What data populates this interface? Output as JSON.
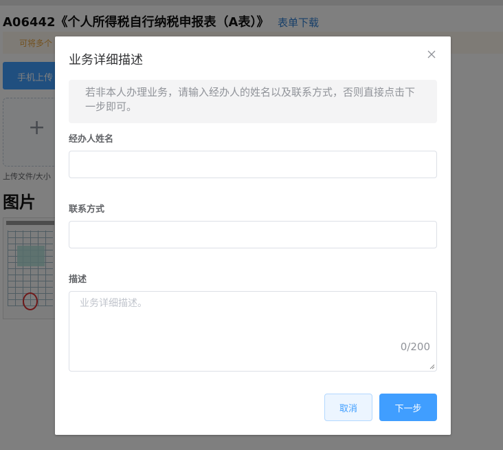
{
  "background": {
    "title": "A06442《个人所得税自行纳税申报表（A表）》",
    "download_link": "表单下载",
    "tip_text": "可将多个",
    "mobile_upload_button": "手机上传",
    "upload_tip": "上传文件/大小",
    "images_heading": "图片"
  },
  "dialog": {
    "title": "业务详细描述",
    "close_icon": "close-icon",
    "notice": "若非本人办理业务，请输入经办人的姓名以及联系方式，否则直接点击下一步即可。",
    "fields": {
      "name_label": "经办人姓名",
      "name_value": "",
      "contact_label": "联系方式",
      "contact_value": "",
      "description_label": "描述",
      "description_placeholder": "业务详细描述。",
      "description_value": "",
      "description_counter": "0/200"
    },
    "buttons": {
      "cancel": "取消",
      "next": "下一步"
    }
  },
  "colors": {
    "primary": "#409eff",
    "mask": "rgba(0,0,0,0.5)",
    "notice_bg": "#f4f4f5",
    "warning_text": "#e6a23c"
  }
}
